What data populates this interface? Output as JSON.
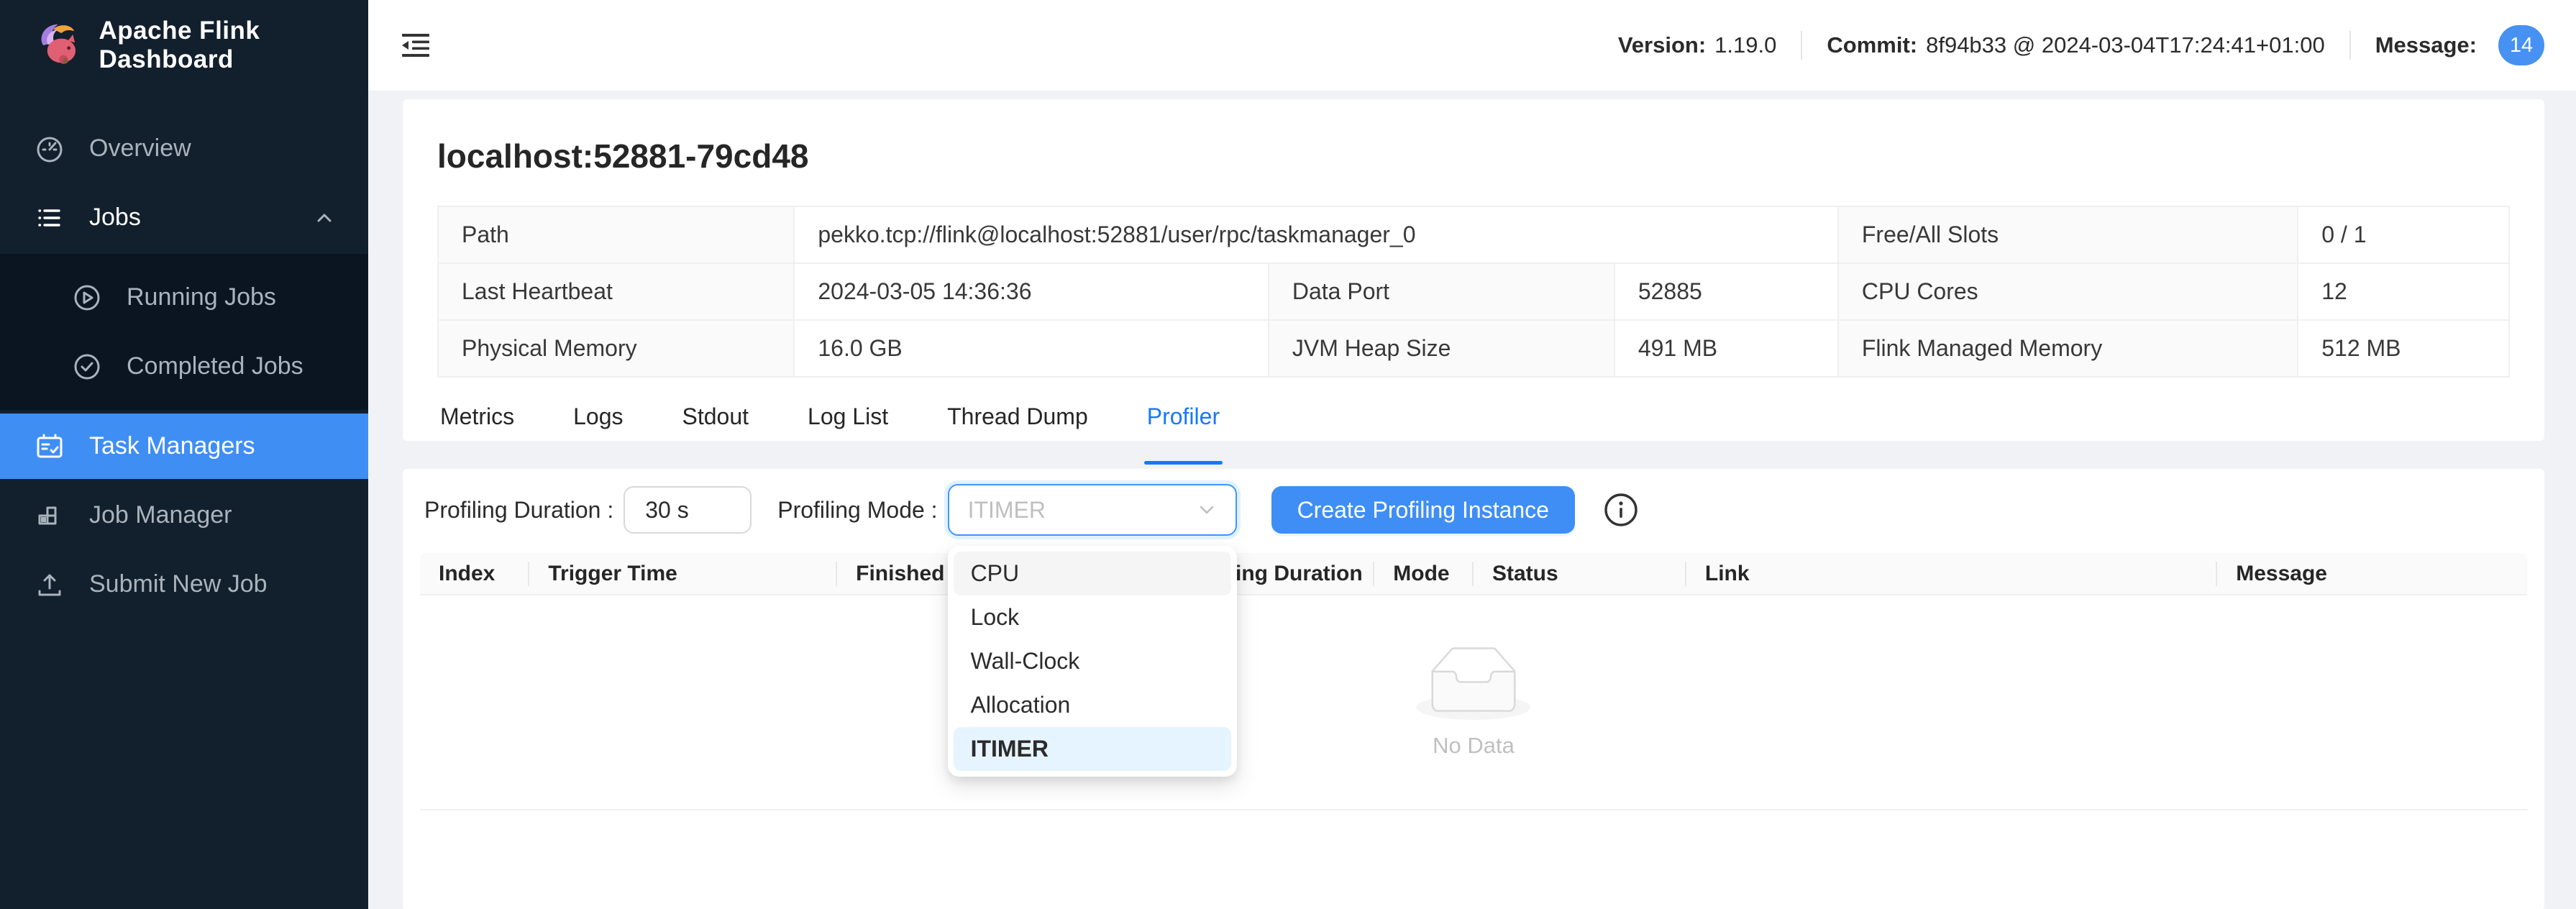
{
  "colors": {
    "accent": "#1677ff",
    "button_blue": "#3f8ef5",
    "sidebar_bg": "#121f2d",
    "submenu_bg": "#0a1521",
    "selected_item_bg": "#3f8ef3",
    "badge_bg": "#4691f2",
    "option_selected_bg": "#e6f4ff"
  },
  "sidebar": {
    "title": "Apache Flink Dashboard",
    "items": [
      {
        "label": "Overview",
        "icon": "dashboard-icon"
      },
      {
        "label": "Jobs",
        "icon": "unordered-list-icon",
        "expanded": true
      },
      {
        "label": "Running Jobs",
        "icon": "play-circle-icon"
      },
      {
        "label": "Completed Jobs",
        "icon": "check-circle-icon"
      },
      {
        "label": "Task Managers",
        "icon": "schedule-icon",
        "selected": true
      },
      {
        "label": "Job Manager",
        "icon": "build-icon"
      },
      {
        "label": "Submit New Job",
        "icon": "upload-icon"
      }
    ]
  },
  "header": {
    "version_label": "Version:",
    "version_value": "1.19.0",
    "commit_label": "Commit:",
    "commit_value": "8f94b33 @ 2024-03-04T17:24:41+01:00",
    "message_label": "Message:",
    "message_count": "14"
  },
  "page": {
    "title": "localhost:52881-79cd48"
  },
  "info": {
    "path_label": "Path",
    "path_value": "pekko.tcp://flink@localhost:52881/user/rpc/taskmanager_0",
    "free_slots_label": "Free/All Slots",
    "free_slots_value": "0 / 1",
    "heartbeat_label": "Last Heartbeat",
    "heartbeat_value": "2024-03-05 14:36:36",
    "data_port_label": "Data Port",
    "data_port_value": "52885",
    "cpu_label": "CPU Cores",
    "cpu_value": "12",
    "phys_label": "Physical Memory",
    "phys_value": "16.0 GB",
    "jvm_label": "JVM Heap Size",
    "jvm_value": "491 MB",
    "managed_label": "Flink Managed Memory",
    "managed_value": "512 MB"
  },
  "tabs": [
    {
      "label": "Metrics"
    },
    {
      "label": "Logs"
    },
    {
      "label": "Stdout"
    },
    {
      "label": "Log List"
    },
    {
      "label": "Thread Dump"
    },
    {
      "label": "Profiler",
      "active": true
    }
  ],
  "profiler": {
    "duration_label": "Profiling Duration :",
    "duration_value": "30 s",
    "mode_label": "Profiling Mode :",
    "mode_value": "ITIMER",
    "create_button": "Create Profiling Instance",
    "columns": [
      "Index",
      "Trigger Time",
      "Finished Time",
      "Profiling Duration",
      "Mode",
      "Status",
      "Link",
      "Message"
    ],
    "mode_options": [
      {
        "label": "CPU",
        "state": "hover"
      },
      {
        "label": "Lock",
        "state": "normal"
      },
      {
        "label": "Wall-Clock",
        "state": "normal"
      },
      {
        "label": "Allocation",
        "state": "normal"
      },
      {
        "label": "ITIMER",
        "state": "selected"
      }
    ],
    "empty_text": "No Data"
  }
}
